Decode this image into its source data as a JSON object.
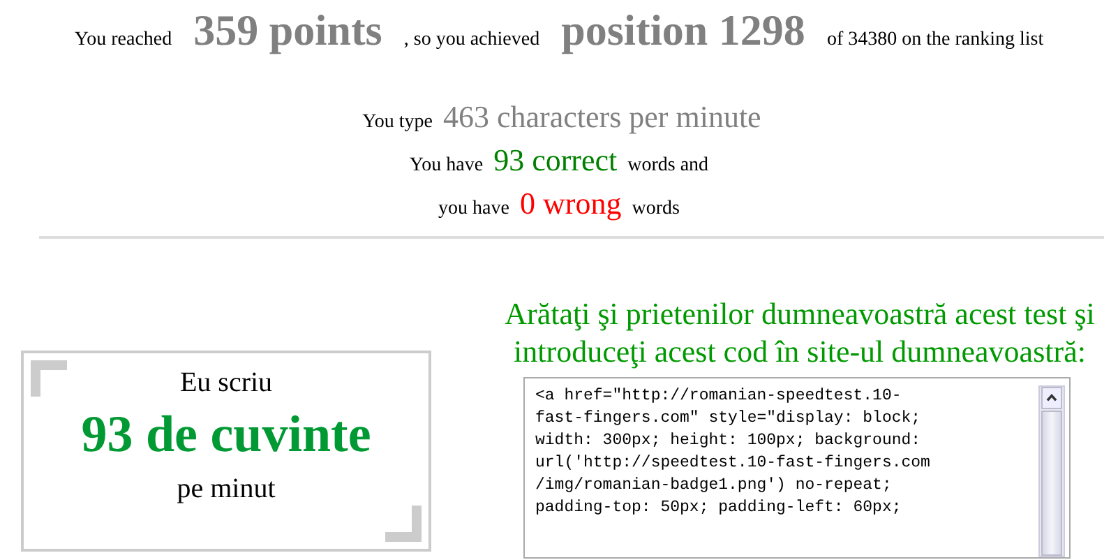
{
  "result_line": [
    {
      "kind": "plain",
      "text": "You reached"
    },
    {
      "kind": "big",
      "text": "359 points"
    },
    {
      "kind": "plain",
      "text": ", so you achieved"
    },
    {
      "kind": "big",
      "text": "position 1298"
    },
    {
      "kind": "plain",
      "text": "of 34380 on the ranking list"
    }
  ],
  "stats": [
    [
      {
        "kind": "plain",
        "text": "You type"
      },
      {
        "kind": "grey",
        "text": "463 characters per minute"
      }
    ],
    [
      {
        "kind": "plain",
        "text": "You have"
      },
      {
        "kind": "correct",
        "text": "93 correct"
      },
      {
        "kind": "plain",
        "text": "words and"
      }
    ],
    [
      {
        "kind": "plain",
        "text": "you have"
      },
      {
        "kind": "wrong",
        "text": "0 wrong"
      },
      {
        "kind": "plain",
        "text": "words"
      }
    ]
  ],
  "badge": {
    "top": "Eu scriu",
    "main": "93 de cuvinte",
    "bottom": "pe minut"
  },
  "share": {
    "heading": "Arătaţi şi prietenilor dumneavoastră acest test şi introduceţi acest cod în site-ul dumneavoastră:",
    "code_lines": [
      "<a href=\"http://romanian-speedtest.10-",
      "fast-fingers.com\" style=\"display: block;",
      "width: 300px; height: 100px; background:",
      "url('http://speedtest.10-fast-fingers.com",
      "/img/romanian-badge1.png') no-repeat;",
      "padding-top: 50px; padding-left: 60px;"
    ]
  }
}
